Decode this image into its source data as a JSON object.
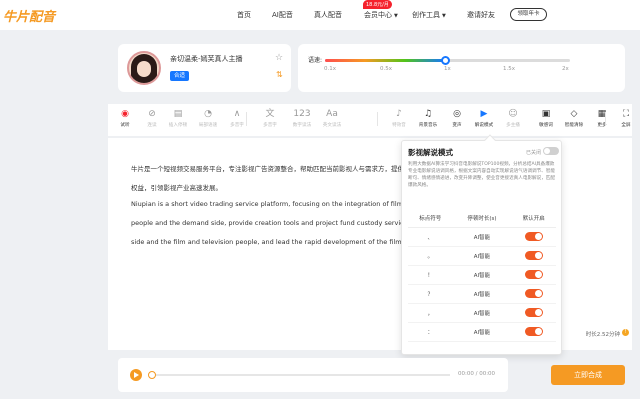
{
  "nav": {
    "logo": "牛片配音",
    "items": [
      "首页",
      "AI配音",
      "真人配音",
      "会员中心",
      "创作工具",
      "邀请好友"
    ],
    "badge": "18.8元/月",
    "button": "领取年卡"
  },
  "voice": {
    "name": "亲切温柔-嫣芙真人主播",
    "tag": "合适"
  },
  "speed": {
    "label": "语速:",
    "ticks": [
      "0.1x",
      "0.5x",
      "1x",
      "1.5x",
      "2x"
    ],
    "value": 1.0,
    "accent": "#1677ff"
  },
  "toolbar": [
    {
      "label": "试听",
      "icon": "play-circle-icon",
      "state": "red"
    },
    {
      "label": "连读",
      "icon": "link-icon",
      "state": "off"
    },
    {
      "label": "插入停顿",
      "icon": "insert-pause-icon",
      "state": "off"
    },
    {
      "label": "局部语速",
      "icon": "speedometer-icon",
      "state": "off"
    },
    {
      "label": "多音字",
      "icon": "polyphone-icon",
      "state": "off"
    },
    {
      "label": "多音字",
      "icon": "pinyin-icon",
      "state": "off"
    },
    {
      "label": "数字读法",
      "icon": "number-icon",
      "state": "off"
    },
    {
      "label": "英文读法",
      "icon": "english-icon",
      "state": "off"
    },
    {
      "label": "特效音",
      "icon": "sound-effect-icon",
      "state": "off"
    },
    {
      "label": "背景音乐",
      "icon": "music-icon",
      "state": "on"
    },
    {
      "label": "变声",
      "icon": "voice-change-icon",
      "state": "on"
    },
    {
      "label": "解说模式",
      "icon": "narration-icon",
      "state": "on"
    },
    {
      "label": "多主播",
      "icon": "multi-anchor-icon",
      "state": "off"
    },
    {
      "label": "敏感词",
      "icon": "sensitive-word-icon",
      "state": "on"
    },
    {
      "label": "智能清除",
      "icon": "eraser-icon",
      "state": "on"
    },
    {
      "label": "更多",
      "icon": "grid-icon",
      "state": "on"
    },
    {
      "label": "全屏",
      "icon": "fullscreen-icon",
      "state": "on"
    }
  ],
  "editor": {
    "paragraphs": [
      "牛片是一个短视频交易服务平台，专注影视广告资源整合，帮助匹配当前影视人与需求方，提供         方与影视人的",
      "权益，引领影视产业高速发展。",
      "Niupian is a short video trading service platform, focusing on the integration of film and television         and television",
      "people and the demand side, provide creation tools and project fund custody services, improve         the demand",
      "side and the film and television people, and lead the rapid development of the film and television"
    ],
    "duration": "时长2.52分钟"
  },
  "popup": {
    "title": "影视解说模式",
    "status": "已关闭",
    "description": "利用大数据AI算法学习抖音电影解说TOP100视频，分析总结AI具备爆款专业电影解说语调风格，根据文案内容自动实现解说语气语调调节、智能断句、情绪感情递进，改变升降调整，使业音更接近真人电影解说，匹配爆款风格。",
    "headers": [
      "标点符号",
      "停顿时长(s)",
      "默认开启"
    ],
    "rows": [
      {
        "symbol": "、",
        "duration": "AI智能"
      },
      {
        "symbol": "。",
        "duration": "AI智能"
      },
      {
        "symbol": "！",
        "duration": "AI智能"
      },
      {
        "symbol": "？",
        "duration": "AI智能"
      },
      {
        "symbol": "，",
        "duration": "AI智能"
      },
      {
        "symbol": "：",
        "duration": "AI智能"
      }
    ],
    "toggle_color": "#f05a24"
  },
  "player": {
    "time": "00:00 / 00:00",
    "synth_label": "立即合成",
    "progress": 0
  }
}
